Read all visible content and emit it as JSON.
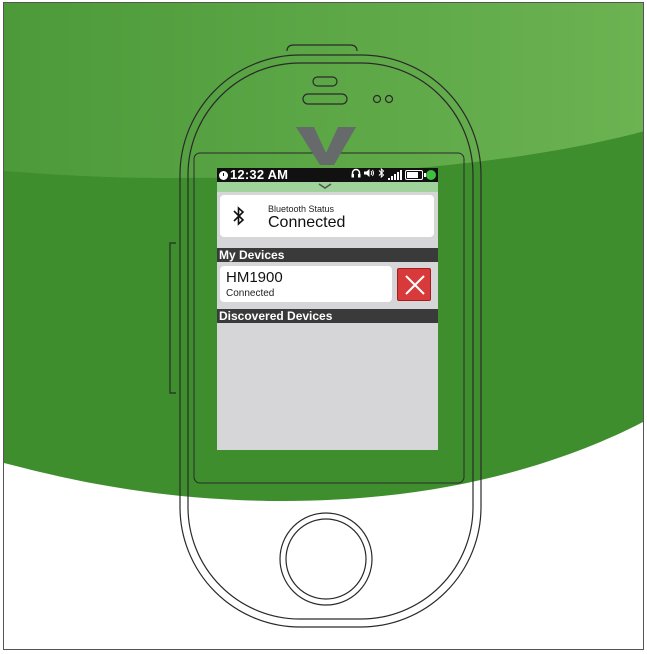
{
  "colors": {
    "background_green": "#4a9d35",
    "background_light_green": "#6ab04c",
    "accent_green": "#3fbf3f",
    "remove_red": "#d8393a",
    "screen_gray": "#d6d6d8",
    "header_dark": "#3a3a3a"
  },
  "status_bar": {
    "time": "12:32 AM",
    "icons": [
      "clock-icon",
      "headphones-icon",
      "volume-icon",
      "bluetooth-icon",
      "signal-icon",
      "battery-icon",
      "status-dot-icon"
    ]
  },
  "bluetooth": {
    "label": "Bluetooth Status",
    "value": "Connected"
  },
  "my_devices": {
    "header": "My Devices",
    "items": [
      {
        "name": "HM1900",
        "status": "Connected"
      }
    ]
  },
  "discovered_devices": {
    "header": "Discovered Devices",
    "items": []
  }
}
